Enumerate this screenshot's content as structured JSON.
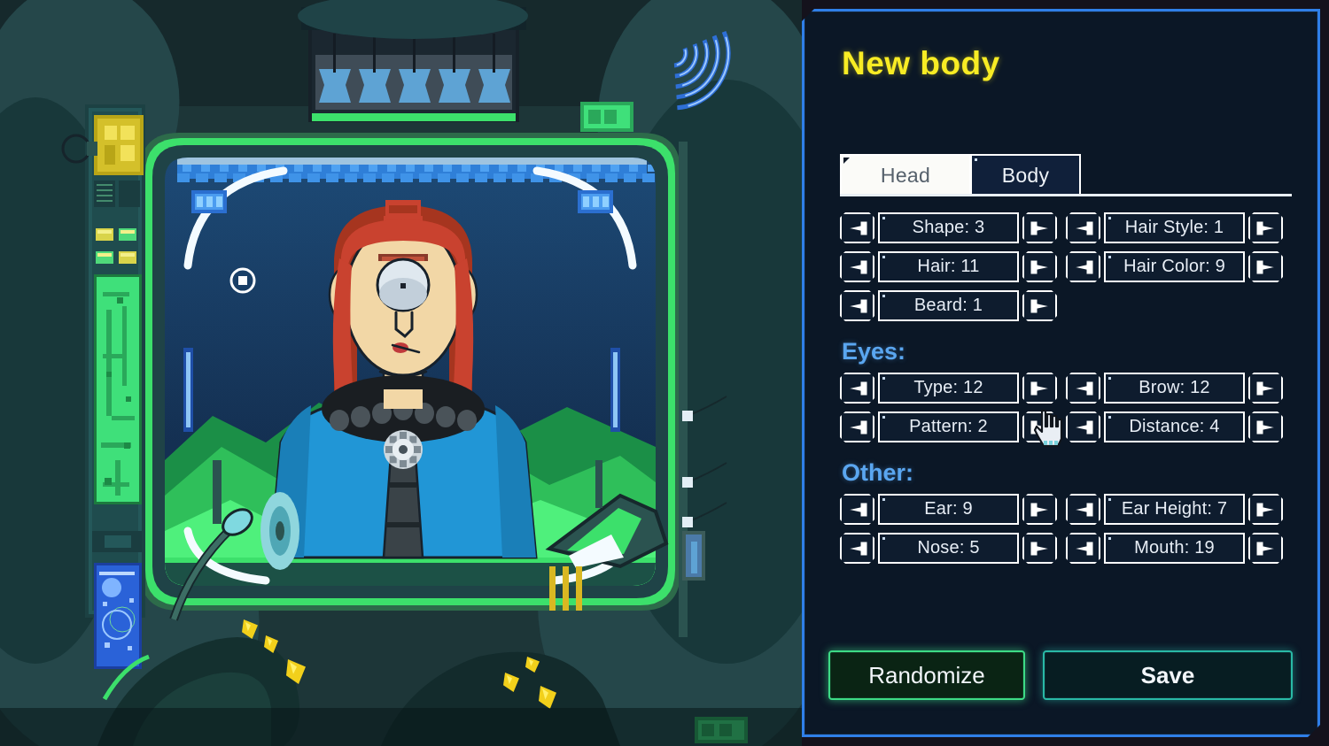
{
  "panel": {
    "title": "New body",
    "tabs": [
      {
        "label": "Head",
        "active": true
      },
      {
        "label": "Body",
        "active": false
      }
    ],
    "top_controls": [
      {
        "name": "shape",
        "label": "Shape: 3",
        "property": "Shape",
        "value": 3,
        "column": "left"
      },
      {
        "name": "hair-style",
        "label": "Hair Style: 1",
        "property": "Hair Style",
        "value": 1,
        "column": "right"
      },
      {
        "name": "hair",
        "label": "Hair: 11",
        "property": "Hair",
        "value": 11,
        "column": "left"
      },
      {
        "name": "hair-color",
        "label": "Hair Color: 9",
        "property": "Hair Color",
        "value": 9,
        "column": "right"
      },
      {
        "name": "beard",
        "label": "Beard: 1",
        "property": "Beard",
        "value": 1,
        "column": "left"
      }
    ],
    "sections": [
      {
        "name": "eyes",
        "heading": "Eyes:",
        "controls": [
          {
            "name": "eye-type",
            "label": "Type: 12",
            "property": "Type",
            "value": 12,
            "column": "left"
          },
          {
            "name": "eye-brow",
            "label": "Brow: 12",
            "property": "Brow",
            "value": 12,
            "column": "right"
          },
          {
            "name": "eye-pattern",
            "label": "Pattern: 2",
            "property": "Pattern",
            "value": 2,
            "column": "left"
          },
          {
            "name": "eye-distance",
            "label": "Distance: 4",
            "property": "Distance",
            "value": 4,
            "column": "right"
          }
        ]
      },
      {
        "name": "other",
        "heading": "Other:",
        "controls": [
          {
            "name": "ear",
            "label": "Ear: 9",
            "property": "Ear",
            "value": 9,
            "column": "left"
          },
          {
            "name": "ear-height",
            "label": "Ear Height: 7",
            "property": "Ear Height",
            "value": 7,
            "column": "right"
          },
          {
            "name": "nose",
            "label": "Nose: 5",
            "property": "Nose",
            "value": 5,
            "column": "left"
          },
          {
            "name": "mouth",
            "label": "Mouth: 19",
            "property": "Mouth",
            "value": 19,
            "column": "right"
          }
        ]
      }
    ],
    "buttons": {
      "randomize": "Randomize",
      "save": "Save"
    },
    "icons": {
      "prev": "caret-left-icon",
      "next": "caret-right-icon",
      "cursor": "pointing-hand-cursor"
    },
    "colors": {
      "panel_background": "#0b1726",
      "panel_border": "#2f7fe8",
      "title": "#f8ec24",
      "section_heading": "#5aa6f0",
      "control_border": "#ffffff",
      "control_background": "#0e1c2e",
      "control_text": "#e8eef6",
      "tab_active_background": "#fbfbf8",
      "tab_active_text": "#56616c",
      "tab_inactive_text": "#eef3f8",
      "randomize_border": "#3ddb86",
      "save_border": "#29b9a6"
    }
  },
  "scene": {
    "name": "character-creation-chamber",
    "description": "Pixel-art cloning pod showing a one-eyed character with red hair and a blue jacket",
    "colors": {
      "room_dark": "#1d3638",
      "room_mid": "#2b5350",
      "glow_green": "#3ce06b",
      "pod_sky_top": "#1b3f66",
      "pod_sky_bottom": "#14304f",
      "hill_green": "#2fbf5a",
      "skin": "#f2d7a6",
      "hair_red": "#c9422f",
      "hair_red_dark": "#a6351f",
      "jacket_blue": "#2196d6",
      "collar_dark": "#1a1e22",
      "eye_white": "#dfe8ef",
      "panel_yellow": "#c8b41a",
      "screen_blue": "#2a62d8",
      "crystal_yellow": "#f2d01b"
    }
  }
}
